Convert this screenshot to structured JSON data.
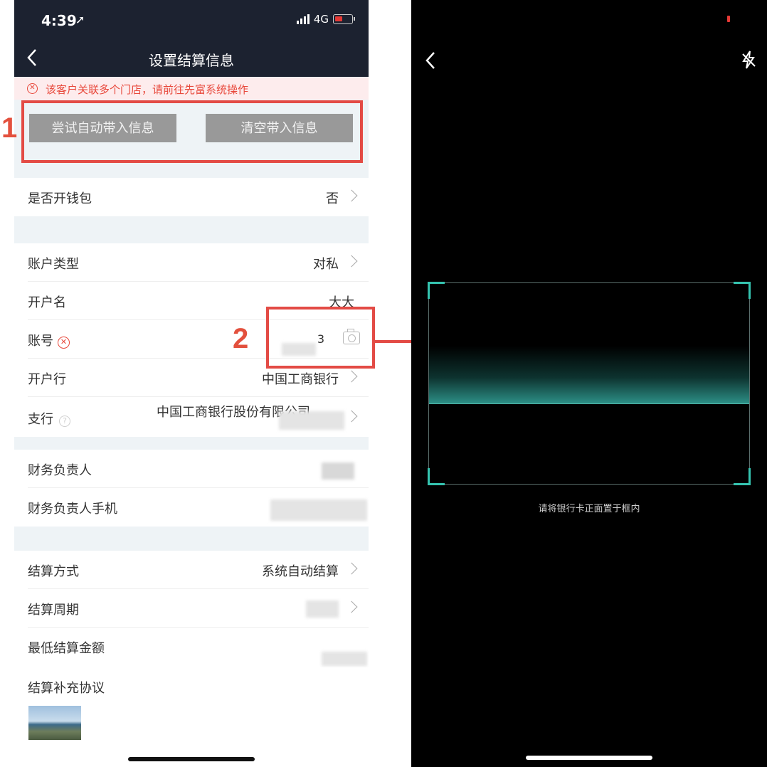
{
  "left_phone": {
    "status_bar": {
      "time": "4:39",
      "network": "4G"
    },
    "nav": {
      "title": "设置结算信息"
    },
    "warning": {
      "text": "该客户关联多个门店，请前往先富系统操作"
    },
    "buttons": {
      "auto_fill": "尝试自动带入信息",
      "clear_fill": "清空带入信息"
    },
    "rows": {
      "wallet": {
        "label": "是否开钱包",
        "value": "否"
      },
      "account_type": {
        "label": "账户类型",
        "value": "对私"
      },
      "account_name": {
        "label": "开户名",
        "value": "大大"
      },
      "account_number": {
        "label": "账号",
        "value": "3"
      },
      "bank": {
        "label": "开户行",
        "value": "中国工商银行"
      },
      "branch": {
        "label": "支行",
        "value": "中国工商银行股份有限公司"
      },
      "finance_person": {
        "label": "财务负责人"
      },
      "finance_phone": {
        "label": "财务负责人手机"
      },
      "settle_method": {
        "label": "结算方式",
        "value": "系统自动结算"
      },
      "settle_period": {
        "label": "结算周期"
      },
      "min_amount": {
        "label": "最低结算金额"
      },
      "agreement": {
        "label": "结算补充协议"
      }
    }
  },
  "annotations": {
    "box1_number": "1",
    "box2_number": "2"
  },
  "right_phone": {
    "hint": "请将银行卡正面置于框内"
  },
  "colors": {
    "nav_bg": "#1c2230",
    "annotation_red": "#e34b45",
    "scan_accent": "#35c4b0",
    "warning_red": "#e8483b"
  },
  "icons": [
    "location-arrow-icon",
    "signal-icon",
    "battery-icon",
    "back-chevron-icon",
    "error-circle-icon",
    "camera-icon",
    "help-circle-icon",
    "chevron-right-icon",
    "flash-off-icon"
  ]
}
